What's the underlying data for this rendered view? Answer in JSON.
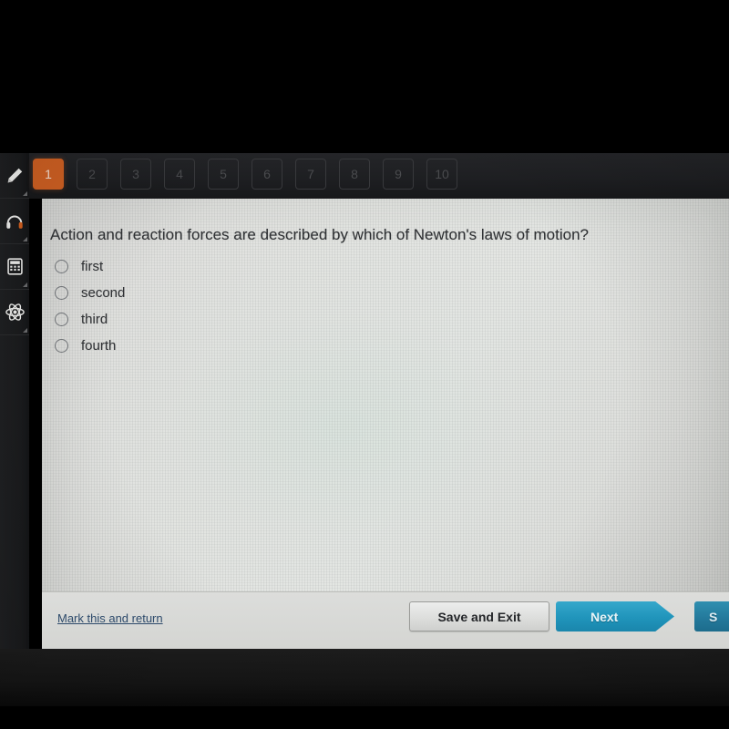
{
  "tool_rail": {
    "items": [
      {
        "name": "highlighter-icon",
        "label": "Highlighter"
      },
      {
        "name": "headphones-icon",
        "label": "Audio"
      },
      {
        "name": "calculator-icon",
        "label": "Calculator"
      },
      {
        "name": "atom-icon",
        "label": "Periodic table"
      }
    ]
  },
  "question_nav": {
    "active_index": 0,
    "items": [
      "1",
      "2",
      "3",
      "4",
      "5",
      "6",
      "7",
      "8",
      "9",
      "10"
    ]
  },
  "question": {
    "text": "Action and reaction forces are described by which of Newton's laws of motion?",
    "choices": [
      {
        "label": "first",
        "selected": false
      },
      {
        "label": "second",
        "selected": false
      },
      {
        "label": "third",
        "selected": false
      },
      {
        "label": "fourth",
        "selected": false
      }
    ]
  },
  "actions": {
    "mark_return_label": "Mark this and return",
    "save_exit_label": "Save and Exit",
    "next_label": "Next",
    "submit_label": "S"
  },
  "colors": {
    "accent_orange": "#cd5f22",
    "next_blue": "#2094bb",
    "link_blue": "#2d4a6b",
    "panel_bg": "#e2e3e0",
    "rail_bg": "#1f2022"
  }
}
